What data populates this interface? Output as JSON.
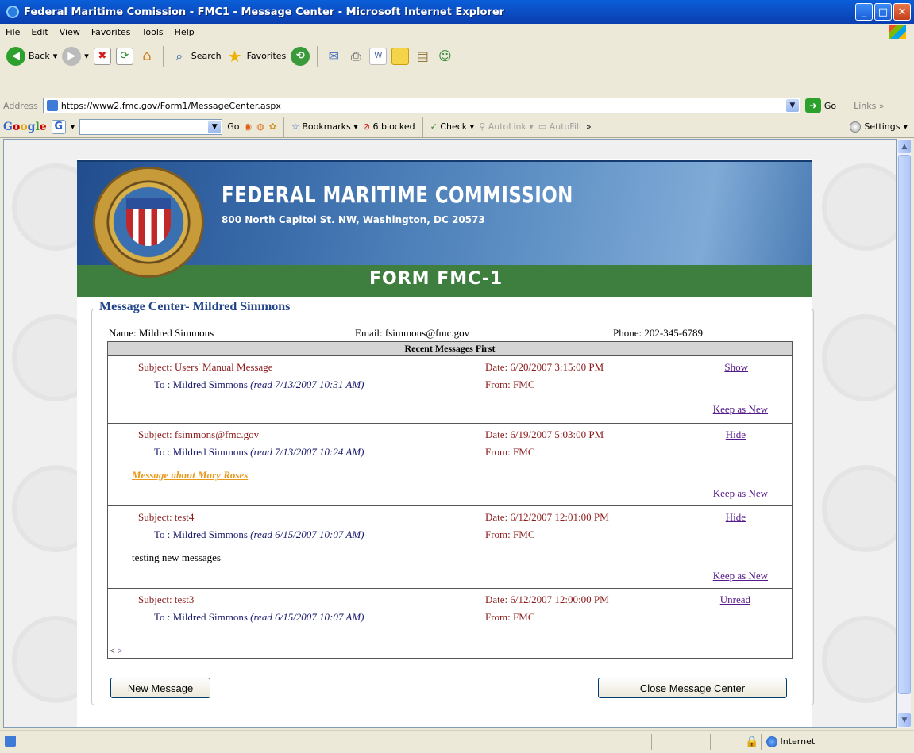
{
  "window": {
    "title": "Federal Maritime Comission - FMC1 - Message Center - Microsoft Internet Explorer",
    "buttons": {
      "minimize": "_",
      "maximize": "□",
      "close": "✕"
    }
  },
  "menu": [
    "File",
    "Edit",
    "View",
    "Favorites",
    "Tools",
    "Help"
  ],
  "toolbar": {
    "back": "Back",
    "search": "Search",
    "favorites": "Favorites"
  },
  "address": {
    "label": "Address",
    "url": "https://www2.fmc.gov/Form1/MessageCenter.aspx",
    "go": "Go",
    "links": "Links"
  },
  "google": {
    "logo": [
      "G",
      "o",
      "o",
      "g",
      "l",
      "e"
    ],
    "go": "Go",
    "bookmarks": "Bookmarks",
    "blocked": "6 blocked",
    "check": "Check",
    "autolink": "AutoLink",
    "autofill": "AutoFill",
    "settings": "Settings"
  },
  "header": {
    "agency": "FEDERAL MARITIME COMMISSION",
    "address": "800 North Capitol St. NW, Washington, DC 20573",
    "form": "FORM FMC-1"
  },
  "center": {
    "title": "Message Center- Mildred Simmons",
    "name": "Name:  Mildred Simmons",
    "email": "Email: fsimmons@fmc.gov",
    "phone": "Phone: 202-345-6789",
    "table_header": "Recent Messages First",
    "pager_prev": "<",
    "pager_next": ">"
  },
  "messages": [
    {
      "subject": "Subject: Users' Manual Message",
      "to": "To : Mildred Simmons",
      "read": "(read 7/13/2007 10:31 AM)",
      "date": "Date: 6/20/2007 3:15:00 PM",
      "from": "From: FMC",
      "action": "Show",
      "keep": "Keep as New"
    },
    {
      "subject": "Subject: fsimmons@fmc.gov",
      "to": "To : Mildred Simmons",
      "read": "(read 7/13/2007 10:24 AM)",
      "date": "Date: 6/19/2007 5:03:00 PM",
      "from": "From: FMC",
      "action": "Hide",
      "body": "Message about Mary Roses",
      "keep": "Keep as New"
    },
    {
      "subject": "Subject: test4",
      "to": "To : Mildred Simmons",
      "read": "(read 6/15/2007 10:07 AM)",
      "date": "Date: 6/12/2007 12:01:00 PM",
      "from": "From: FMC",
      "action": "Hide",
      "body": "testing new messages",
      "keep": "Keep as New"
    },
    {
      "subject": "Subject: test3",
      "to": "To : Mildred Simmons",
      "read": "(read 6/15/2007 10:07 AM)",
      "date": "Date: 6/12/2007 12:00:00 PM",
      "from": "From: FMC",
      "action": "Unread"
    }
  ],
  "buttons": {
    "new_message": "New Message",
    "close_center": "Close Message Center"
  },
  "status": {
    "zone": "Internet"
  }
}
